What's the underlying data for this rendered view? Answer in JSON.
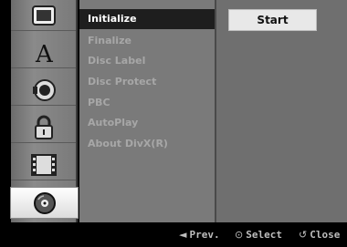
{
  "left_icons": [
    {
      "name": "tv-screen-icon"
    },
    {
      "name": "language-a-icon"
    },
    {
      "name": "speaker-audio-icon"
    },
    {
      "name": "lock-icon"
    },
    {
      "name": "film-record-icon"
    },
    {
      "name": "disc-icon"
    }
  ],
  "menu": {
    "items": [
      {
        "label": "Initialize"
      },
      {
        "label": "Finalize"
      },
      {
        "label": "Disc Label"
      },
      {
        "label": "Disc Protect"
      },
      {
        "label": "PBC"
      },
      {
        "label": "AutoPlay"
      },
      {
        "label": "About DivX(R)"
      }
    ],
    "selected_index": 0
  },
  "right_panel": {
    "start_label": "Start"
  },
  "footer": {
    "prev": {
      "glyph": "◄",
      "label": "Prev."
    },
    "select": {
      "glyph": "⊙",
      "label": "Select"
    },
    "close": {
      "glyph": "↺",
      "label": "Close"
    }
  },
  "colors": {
    "selected_bg": "#1e1e1e",
    "menu_bg": "#7a7a7a",
    "inactive_text": "#a7a7a7",
    "button_bg": "#e8e8e8"
  }
}
